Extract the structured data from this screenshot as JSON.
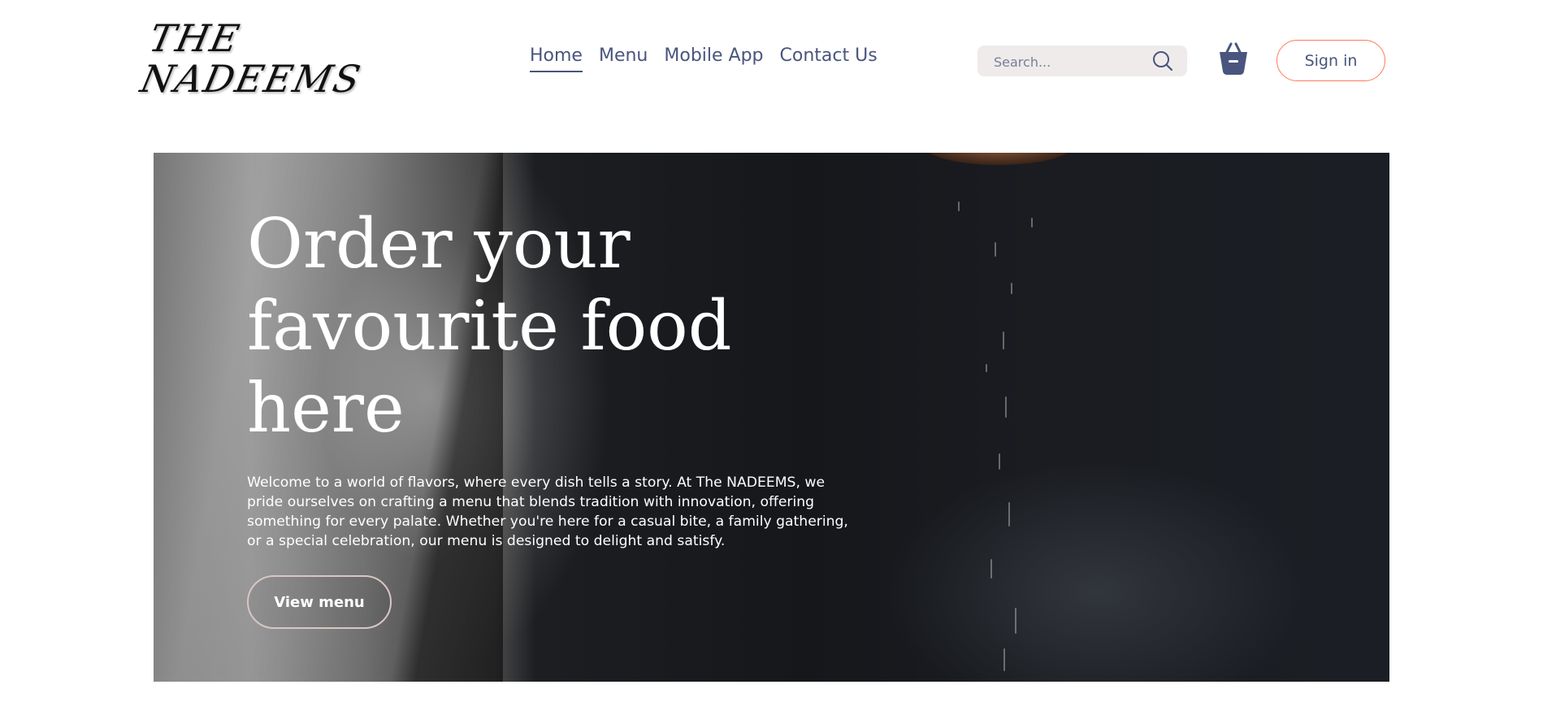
{
  "brand": {
    "logo_line1": "THE",
    "logo_line2": "NADEEMS"
  },
  "nav": {
    "items": [
      {
        "label": "Home",
        "active": true
      },
      {
        "label": "Menu",
        "active": false
      },
      {
        "label": "Mobile App",
        "active": false
      },
      {
        "label": "Contact Us",
        "active": false
      }
    ]
  },
  "search": {
    "placeholder": "Search...",
    "value": "",
    "icon": "search-icon"
  },
  "cart": {
    "icon": "basket-icon"
  },
  "auth": {
    "signin_label": "Sign in"
  },
  "hero": {
    "title": "Order your favourite food here",
    "description": "Welcome to a world of flavors, where every dish tells a story. At The NADEEMS, we pride ourselves on crafting a menu that blends tradition with innovation, offering something for every palate. Whether you're here for a casual bite, a family gathering, or a special celebration, our menu is designed to delight and satisfy.",
    "cta_label": "View menu"
  },
  "colors": {
    "nav_text": "#49557e",
    "search_bg": "#efebea",
    "signin_border": "#ff7a59",
    "cta_border": "#d8c6c4"
  }
}
